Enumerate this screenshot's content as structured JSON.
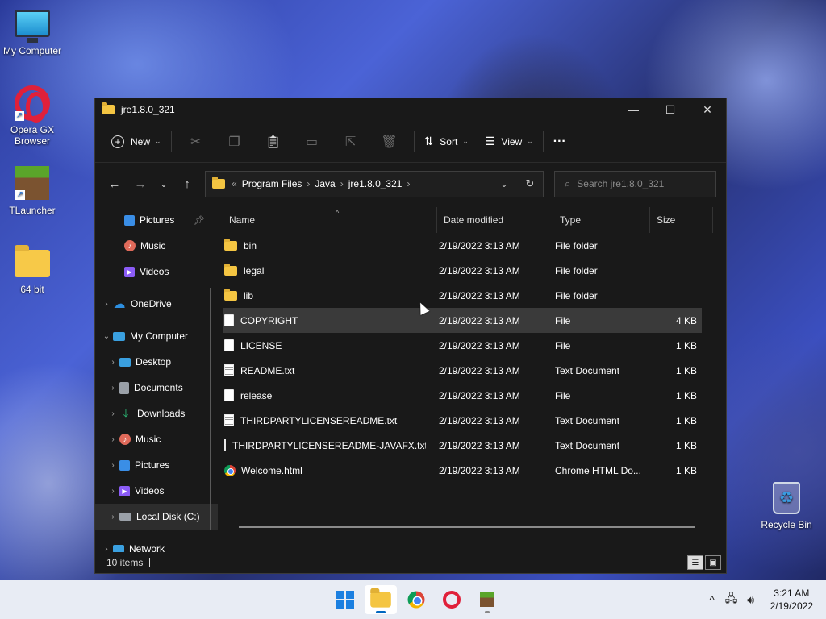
{
  "desktop": {
    "icons": [
      {
        "label": "My Computer"
      },
      {
        "label": "Opera GX Browser"
      },
      {
        "label": "TLauncher"
      },
      {
        "label": "64 bit"
      },
      {
        "label": "Recycle Bin"
      }
    ]
  },
  "window": {
    "title": "jre1.8.0_321",
    "controls": {
      "minimize": "—",
      "maximize": "☐",
      "close": "✕"
    }
  },
  "toolbar": {
    "new_label": "New",
    "sort_label": "Sort",
    "view_label": "View",
    "more_label": "···"
  },
  "address": {
    "overflow": "«",
    "crumbs": [
      "Program Files",
      "Java",
      "jre1.8.0_321"
    ],
    "search_placeholder": "Search jre1.8.0_321"
  },
  "sidebar": {
    "items": [
      {
        "label": "Pictures",
        "icon": "pictures-icon",
        "color": "#3a8ee6"
      },
      {
        "label": "Music",
        "icon": "music-icon",
        "color": "#e06a5a"
      },
      {
        "label": "Videos",
        "icon": "videos-icon",
        "color": "#8b5cf6"
      },
      {
        "label": "OneDrive",
        "icon": "onedrive-icon",
        "color": "#2d8fe0"
      },
      {
        "label": "My Computer",
        "icon": "computer-icon",
        "color": "#3aa0e0"
      },
      {
        "label": "Desktop",
        "icon": "desktop-icon",
        "color": "#3aa0e0"
      },
      {
        "label": "Documents",
        "icon": "documents-icon",
        "color": "#9aa0a8"
      },
      {
        "label": "Downloads",
        "icon": "downloads-icon",
        "color": "#2bb673"
      },
      {
        "label": "Music",
        "icon": "music-icon",
        "color": "#e06a5a"
      },
      {
        "label": "Pictures",
        "icon": "pictures-icon",
        "color": "#3a8ee6"
      },
      {
        "label": "Videos",
        "icon": "videos-icon",
        "color": "#8b5cf6"
      },
      {
        "label": "Local Disk (C:)",
        "icon": "drive-icon",
        "color": "#9aa0a8"
      },
      {
        "label": "Network",
        "icon": "network-icon",
        "color": "#3aa0e0"
      }
    ]
  },
  "columns": {
    "name": "Name",
    "date": "Date modified",
    "type": "Type",
    "size": "Size"
  },
  "files": [
    {
      "name": "bin",
      "date": "2/19/2022 3:13 AM",
      "type": "File folder",
      "size": "",
      "icon": "folder"
    },
    {
      "name": "legal",
      "date": "2/19/2022 3:13 AM",
      "type": "File folder",
      "size": "",
      "icon": "folder"
    },
    {
      "name": "lib",
      "date": "2/19/2022 3:13 AM",
      "type": "File folder",
      "size": "",
      "icon": "folder"
    },
    {
      "name": "COPYRIGHT",
      "date": "2/19/2022 3:13 AM",
      "type": "File",
      "size": "4 KB",
      "icon": "file"
    },
    {
      "name": "LICENSE",
      "date": "2/19/2022 3:13 AM",
      "type": "File",
      "size": "1 KB",
      "icon": "file"
    },
    {
      "name": "README.txt",
      "date": "2/19/2022 3:13 AM",
      "type": "Text Document",
      "size": "1 KB",
      "icon": "text"
    },
    {
      "name": "release",
      "date": "2/19/2022 3:13 AM",
      "type": "File",
      "size": "1 KB",
      "icon": "file"
    },
    {
      "name": "THIRDPARTYLICENSEREADME.txt",
      "date": "2/19/2022 3:13 AM",
      "type": "Text Document",
      "size": "1 KB",
      "icon": "text"
    },
    {
      "name": "THIRDPARTYLICENSEREADME-JAVAFX.txt",
      "date": "2/19/2022 3:13 AM",
      "type": "Text Document",
      "size": "1 KB",
      "icon": "text"
    },
    {
      "name": "Welcome.html",
      "date": "2/19/2022 3:13 AM",
      "type": "Chrome HTML Do...",
      "size": "1 KB",
      "icon": "chrome"
    }
  ],
  "status": {
    "count": "10 items"
  },
  "taskbar": {
    "apps": [
      "start-icon",
      "file-explorer-icon",
      "chrome-icon",
      "opera-gx-icon",
      "tlauncher-icon"
    ],
    "time": "3:21 AM",
    "date": "2/19/2022"
  }
}
